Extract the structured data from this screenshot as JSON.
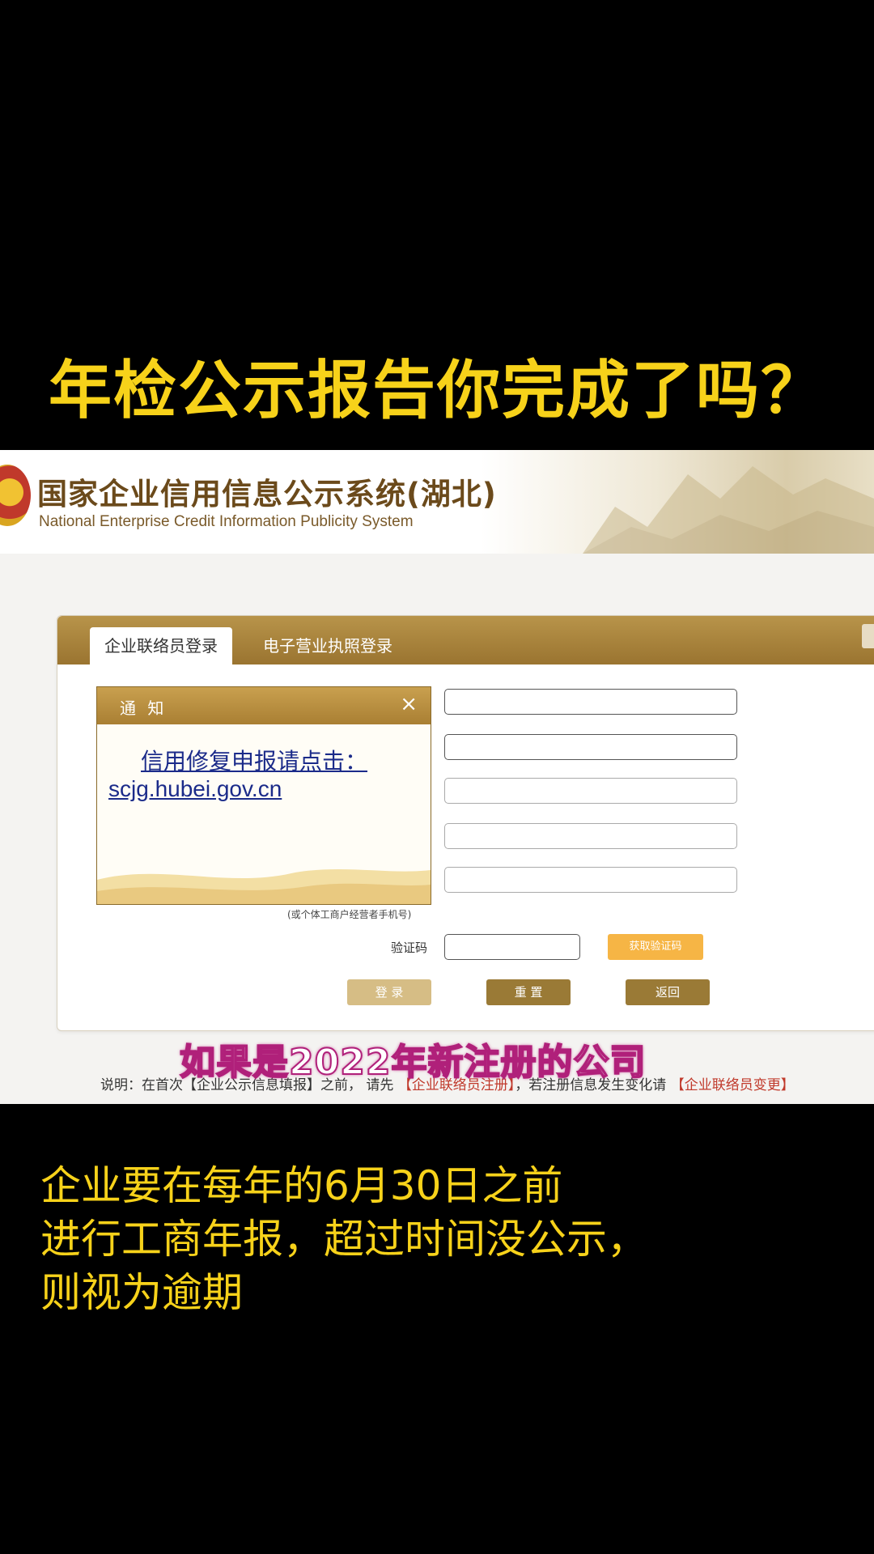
{
  "caption_top": "年检公示报告你完成了吗？",
  "site": {
    "title_cn": "国家企业信用信息公示系统(湖北)",
    "title_en": "National Enterprise Credit Information Publicity System"
  },
  "tabs": [
    {
      "label": "企业联络员登录"
    },
    {
      "label": "电子营业执照登录"
    }
  ],
  "form": {
    "phone_note": "(或个体工商户经营者手机号)",
    "captcha_label": "验证码",
    "captcha_button": "获取验证码",
    "login_button": "登 录",
    "reset_button": "重 置",
    "back_button": "返回"
  },
  "notice": {
    "title": "通 知",
    "close": "×",
    "line1": "信用修复申报请点击：",
    "line2": "scjg.hubei.gov.cn"
  },
  "overlay_subtitle": "如果是2022年新注册的公司",
  "footnote": {
    "prefix": "说明：在首次",
    "link1": "【企业公示信息填报】",
    "mid1": "之前，  请先",
    "link2": "【企业联络员注册】",
    "mid2": "，若注册信息发生变化请",
    "link3": "【企业联络员变更】"
  },
  "caption_bottom": [
    "企业要在每年的6月30日之前",
    "进行工商年报，超过时间没公示，",
    "则视为逾期"
  ],
  "colors": {
    "caption": "#f7d21a",
    "gold": "#a97f33",
    "link": "#1b2b8a"
  }
}
